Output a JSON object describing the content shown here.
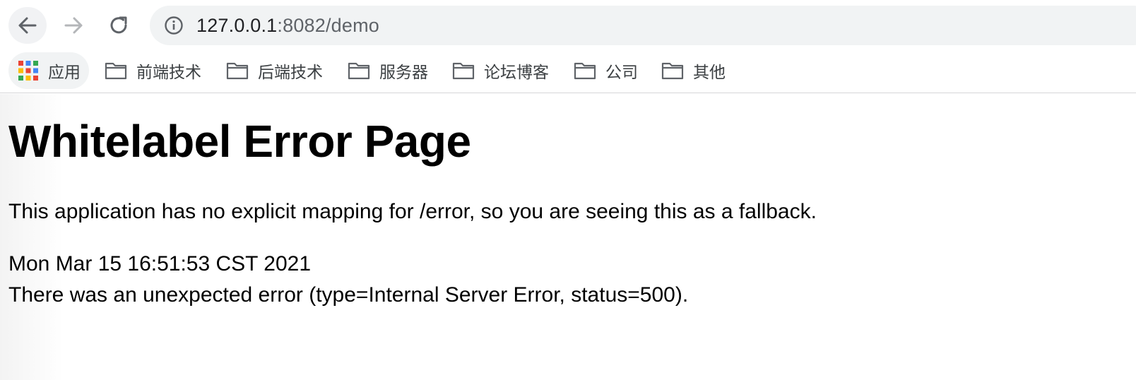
{
  "browser": {
    "url_host": "127.0.0.1",
    "url_rest": ":8082/demo"
  },
  "bookmarks": {
    "apps_label": "应用",
    "folders": [
      "前端技术",
      "后端技术",
      "服务器",
      "论坛博客",
      "公司",
      "其他"
    ]
  },
  "page": {
    "title": "Whitelabel Error Page",
    "message": "This application has no explicit mapping for /error, so you are seeing this as a fallback.",
    "timestamp": "Mon Mar 15 16:51:53 CST 2021",
    "error": "There was an unexpected error (type=Internal Server Error, status=500)."
  },
  "icons": {
    "back": "arrow-left-icon",
    "forward": "arrow-right-icon",
    "reload": "reload-icon",
    "info": "info-icon",
    "apps": "apps-grid-icon",
    "folder": "folder-icon"
  },
  "colors": {
    "omnibox_bg": "#f1f3f4",
    "text_dim": "#5f6368",
    "apps_grid": [
      "#ea4335",
      "#4285f4",
      "#34a853",
      "#fbbc05",
      "#ea4335",
      "#4285f4",
      "#34a853",
      "#fbbc05",
      "#ea4335"
    ]
  }
}
